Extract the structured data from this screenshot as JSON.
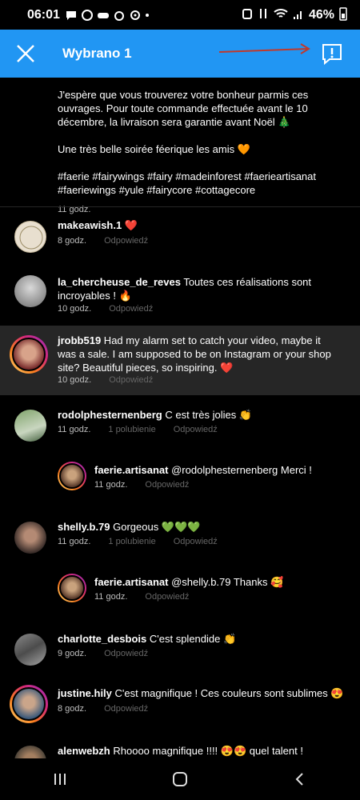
{
  "status": {
    "time": "06:01",
    "battery": "46%"
  },
  "header": {
    "title": "Wybrano 1"
  },
  "caption": {
    "p1": "J'espère que vous trouverez votre bonheur parmis ces ouvrages. Pour toute commande effectuée avant le 10 décembre, la livraison sera garantie avant Noël 🎄",
    "p2": "Une très belle soirée féerique les amis 🧡",
    "tags": "#faerie #fairywings #fairy #madeinforest #faerieartisanat #faeriewings #yule #fairycore #cottagecore",
    "time": "11 godz."
  },
  "labels": {
    "reply": "Odpowiedź",
    "like1": "1 polubienie"
  },
  "comments": [
    {
      "user": "makeawish.1",
      "text": " ❤️",
      "time": "8 godz."
    },
    {
      "user": "la_chercheuse_de_reves",
      "text": " Toutes ces réalisations sont incroyables ! 🔥",
      "time": "10 godz."
    },
    {
      "user": "jrobb519",
      "text": " Had my alarm set to catch your video, maybe it was a sale. I am supposed to be on Instagram or your shop site? Beautiful pieces, so inspiring. ❤️",
      "time": "10 godz."
    },
    {
      "user": "rodolphesternenberg",
      "text": " C est très jolies 👏",
      "time": "11 godz."
    },
    {
      "user": "faerie.artisanat",
      "text": " @rodolphesternenberg Merci !",
      "time": "11 godz."
    },
    {
      "user": "shelly.b.79",
      "text": " Gorgeous 💚💚💚",
      "time": "11 godz."
    },
    {
      "user": "faerie.artisanat",
      "text": " @shelly.b.79 Thanks 🥰",
      "time": "11 godz."
    },
    {
      "user": "charlotte_desbois",
      "text": " C'est splendide 👏",
      "time": "9 godz."
    },
    {
      "user": "justine.hily",
      "text": " C'est magnifique ! Ces couleurs sont sublimes 😍",
      "time": "8 godz."
    },
    {
      "user": "alenwebzh",
      "text": " Rhoooo magnifique !!!! 😍😍 quel talent !",
      "time": ""
    }
  ]
}
